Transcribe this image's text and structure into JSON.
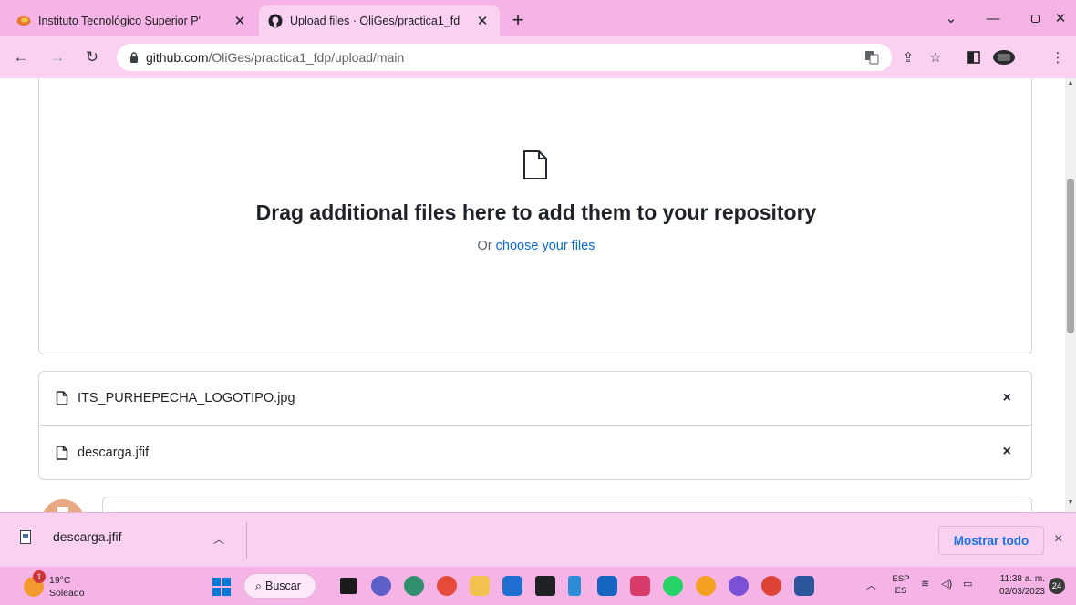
{
  "browser": {
    "tabs": [
      {
        "title": "Instituto Tecnológico Superior P'",
        "active": false,
        "favicon": "its-logo-icon"
      },
      {
        "title": "Upload files · OliGes/practica1_fd",
        "active": true,
        "favicon": "github-icon"
      }
    ],
    "new_tab_label": "+",
    "address": {
      "host": "github.com",
      "path": "/OliGes/practica1_fdp/upload/main"
    }
  },
  "upload": {
    "heading": "Drag additional files here to add them to your repository",
    "or_text": "Or ",
    "choose_link": "choose your files",
    "files": [
      {
        "name": "ITS_PURHEPECHA_LOGOTIPO.jpg"
      },
      {
        "name": "descarga.jfif"
      }
    ],
    "remove_glyph": "×"
  },
  "download_shelf": {
    "item_name": "descarga.jfif",
    "show_all_label": "Mostrar todo",
    "close_glyph": "×"
  },
  "taskbar": {
    "weather_temp": "19°C",
    "weather_desc": "Soleado",
    "weather_badge": "1",
    "search_label": "Buscar",
    "lang_top": "ESP",
    "lang_bottom": "ES",
    "time": "11:38 a. m.",
    "date": "02/03/2023",
    "notification_count": "24"
  },
  "colors": {
    "chrome_frame": "#f5b3e6",
    "chrome_toolbar": "#fad1f0",
    "link": "#0969da",
    "border": "#d0d7de"
  }
}
